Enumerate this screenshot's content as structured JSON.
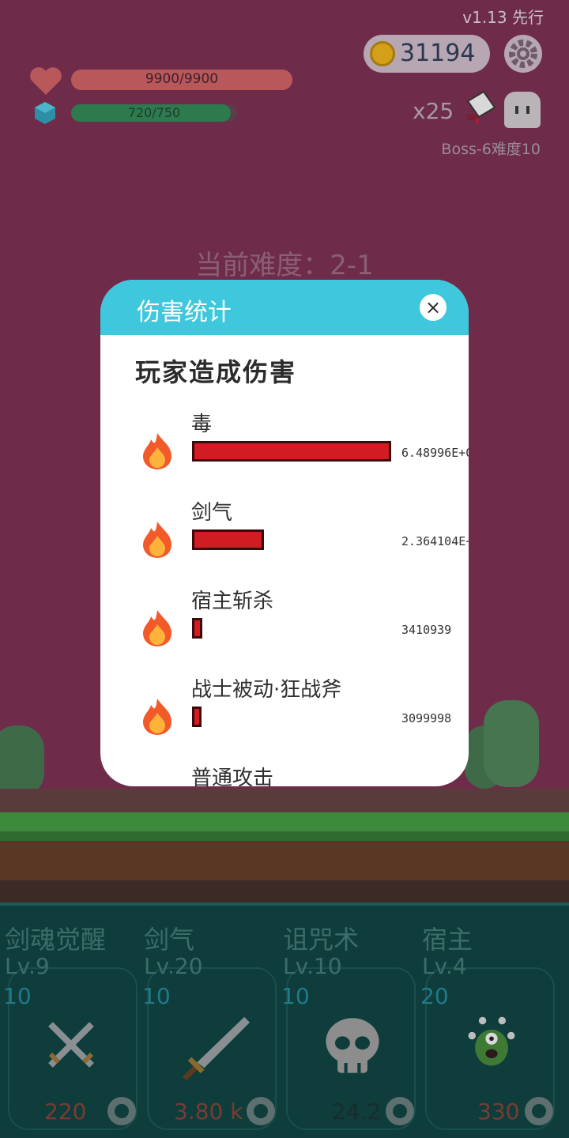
{
  "status": {
    "version": "v1.13 先行",
    "coins": "31194",
    "hp": "9900/9900",
    "hp_fraction": 1.0,
    "mp": "720/750",
    "mp_fraction": 0.96,
    "multiplier": "x25",
    "boss_label": "Boss-6难度10",
    "difficulty": "当前难度：2-1"
  },
  "modal": {
    "title": "伤害统计",
    "close_label": "×",
    "section_title": "玩家造成伤害",
    "rows": [
      {
        "name": "毒",
        "value": "6.48996E+0",
        "fraction": 1.0
      },
      {
        "name": "剑气",
        "value": "2.364104E+",
        "fraction": 0.36
      },
      {
        "name": "宿主斩杀",
        "value": "3410939",
        "fraction": 0.05
      },
      {
        "name": "战士被动·狂战斧",
        "value": "3099998",
        "fraction": 0.04
      },
      {
        "name": "普通攻击",
        "value": "",
        "fraction": 0
      }
    ]
  },
  "skills": [
    {
      "name": "剑魂觉醒",
      "level": "Lv.9",
      "cost": "10",
      "price": "220",
      "icon": "crossed-swords-icon"
    },
    {
      "name": "剑气",
      "level": "Lv.20",
      "cost": "10",
      "price": "3.80 k",
      "icon": "sword-icon"
    },
    {
      "name": "诅咒术",
      "level": "Lv.10",
      "cost": "10",
      "price": "24.2",
      "icon": "skull-icon"
    },
    {
      "name": "宿主",
      "level": "Lv.4",
      "cost": "20",
      "price": "330",
      "icon": "monster-icon"
    }
  ],
  "colors": {
    "modal_header": "#3fc7dd",
    "damage_bar": "#d01c22",
    "background": "#6e2c4a",
    "panel": "#0f3d3b"
  }
}
